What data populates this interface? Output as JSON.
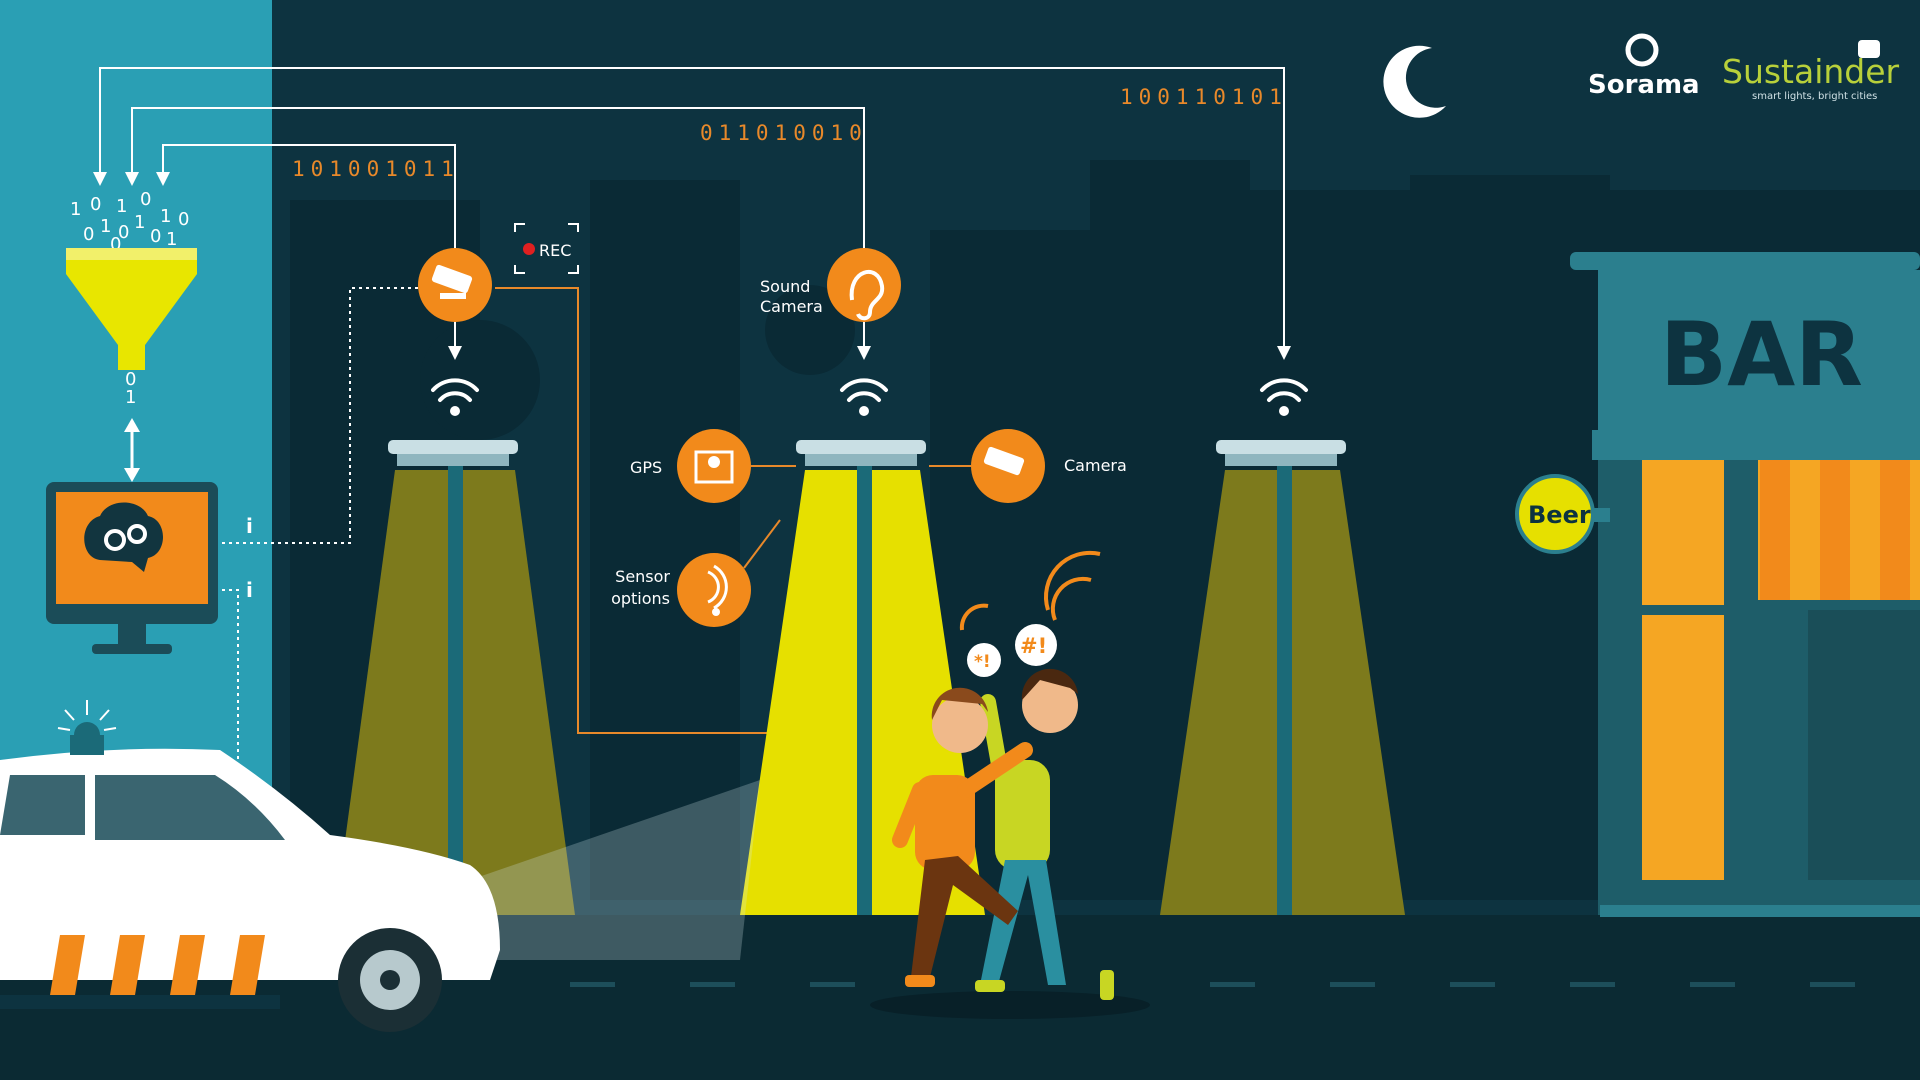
{
  "colors": {
    "sky": "#0d3340",
    "left_panel": "#2a9fb4",
    "orange": "#f28a1b",
    "yellow_light": "#e6e000",
    "olive_light": "#7d7a1c",
    "funnel": "#e8e600",
    "bar_teal": "#2b7f8e",
    "bar_window": "#f5a623"
  },
  "binary_streams": {
    "left": "101001011",
    "middle": "011010010",
    "right": "100110101"
  },
  "funnel_digits": [
    "1",
    "0",
    "1",
    "0",
    "1",
    "0",
    "0",
    "1",
    "0",
    "1",
    "0",
    "1",
    "0"
  ],
  "funnel_output": [
    "0",
    "1"
  ],
  "rec_label": "REC",
  "sensors": {
    "sound_camera": "Sound\nCamera",
    "gps": "GPS",
    "camera": "Camera",
    "sensor_options": "Sensor\noptions"
  },
  "info_marks": [
    "i",
    "i"
  ],
  "speech": {
    "first": "*!",
    "second": "#!"
  },
  "bar_sign": "BAR",
  "beer_sign": "Beer",
  "logos": {
    "sorama": "Sorama",
    "sustainder": "Sustainder",
    "sustainder_tagline": "smart lights, bright cities"
  },
  "icons": [
    "funnel-icon",
    "monitor-brain-gears-icon",
    "cctv-camera-icon",
    "ear-icon",
    "map-pin-icon",
    "sensor-waves-icon",
    "wifi-icon",
    "moon-icon",
    "police-siren-icon"
  ]
}
